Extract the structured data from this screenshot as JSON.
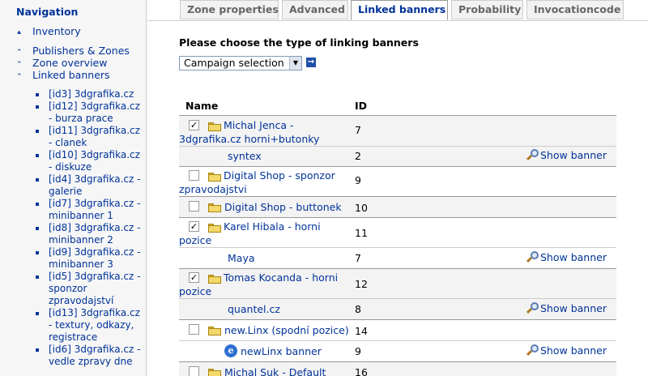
{
  "sidebar": {
    "title": "Navigation",
    "links": [
      {
        "label": "Inventory",
        "arrow": "up-double"
      },
      {
        "label": "Publishers & Zones",
        "arrow": "up"
      },
      {
        "label": "Zone overview",
        "arrow": "up"
      },
      {
        "label": "Linked banners",
        "arrow": "up"
      }
    ],
    "banners": [
      "[id3] 3dgrafika.cz",
      "[id12] 3dgrafika.cz - burza prace",
      "[id11] 3dgrafika.cz - clanek",
      "[id10] 3dgrafika.cz - diskuze",
      "[id4] 3dgrafika.cz - galerie",
      "[id7] 3dgrafika.cz - minibanner 1",
      "[id8] 3dgrafika.cz - minibanner 2",
      "[id9] 3dgrafika.cz - minibanner 3",
      "[id5] 3dgrafika.cz - sponzor zpravodajství",
      "[id13] 3dgrafika.cz - textury, odkazy, registrace",
      "[id6] 3dgrafika.cz - vedle zpravy dne"
    ]
  },
  "tabs": [
    "Zone properties",
    "Advanced",
    "Linked banners",
    "Probability",
    "Invocationcode"
  ],
  "active_tab": "Linked banners",
  "choose_label": "Please choose the type of linking banners",
  "select_value": "Campaign selection",
  "table": {
    "headers": {
      "name": "Name",
      "id": "ID"
    },
    "show_banner_label": "Show banner",
    "campaigns": [
      {
        "name": "Michal Jenca - 3dgrafika.cz horni+butonky",
        "id": "7",
        "checked": true
      },
      {
        "name": "syntex",
        "id": "2",
        "banner": true
      },
      {
        "name": "Digital Shop - sponzor zpravodajstvi",
        "id": "9",
        "checked": false
      },
      {
        "name": "Digital Shop - buttonek",
        "id": "10",
        "checked": false
      },
      {
        "name": "Karel Hibala - horni pozice",
        "id": "11",
        "checked": true
      },
      {
        "name": "Maya",
        "id": "7",
        "banner": true
      },
      {
        "name": "Tomas Kocanda - horni pozice",
        "id": "12",
        "checked": true
      },
      {
        "name": "quantel.cz",
        "id": "8",
        "banner": true
      },
      {
        "name": "new.Linx (spodní pozice)",
        "id": "14",
        "checked": false
      },
      {
        "name": "newLinx banner",
        "id": "9",
        "banner": true
      },
      {
        "name": "Michal Suk - Default",
        "id": "16",
        "checked": false
      }
    ]
  }
}
